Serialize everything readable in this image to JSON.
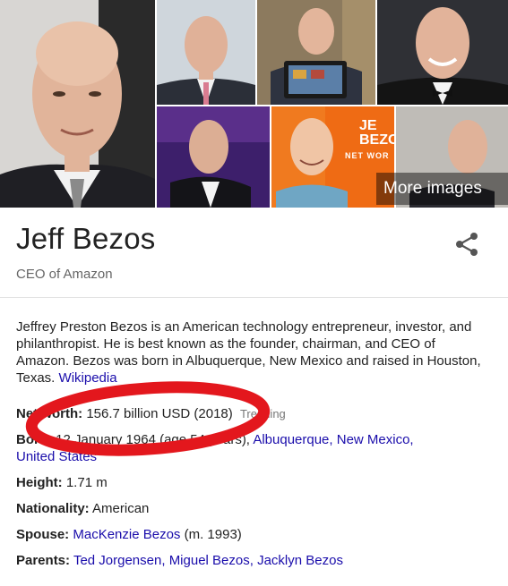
{
  "gallery": {
    "more_images_label": "More images"
  },
  "header": {
    "title": "Jeff Bezos",
    "subtitle": "CEO of Amazon"
  },
  "description": {
    "text": "Jeffrey Preston Bezos is an American technology entrepreneur, investor, and philanthropist. He is best known as the founder, chairman, and CEO of Amazon. Bezos was born in Albuquerque, New Mexico and raised in Houston, Texas.",
    "link": "Wikipedia"
  },
  "facts": {
    "net_worth": {
      "label": "Net worth:",
      "value": "156.7 billion USD (2018)",
      "trend": "Trending"
    },
    "born": {
      "label": "Born:",
      "value": "12 January 1964 (age 54 years),",
      "link1": "Albuquerque",
      "sep": ",",
      "link2": "New Mexico,",
      "link3": "United States"
    },
    "height": {
      "label": "Height:",
      "value": "1.71 m"
    },
    "nationality": {
      "label": "Nationality:",
      "value": "American"
    },
    "spouse": {
      "label": "Spouse:",
      "link": "MacKenzie Bezos",
      "value": "(m. 1993)"
    },
    "parents": {
      "label": "Parents:",
      "link1": "Ted Jorgensen",
      "link2": "Miguel Bezos",
      "link3": "Jacklyn Bezos"
    }
  },
  "book_cover_text": {
    "line1": "JE",
    "line2": "BEZO",
    "line3": "NET WOR"
  },
  "colors": {
    "link": "#1a0dab",
    "annotation": "#e3171d",
    "muted": "#666666"
  },
  "icons": {
    "share": "share-icon"
  }
}
